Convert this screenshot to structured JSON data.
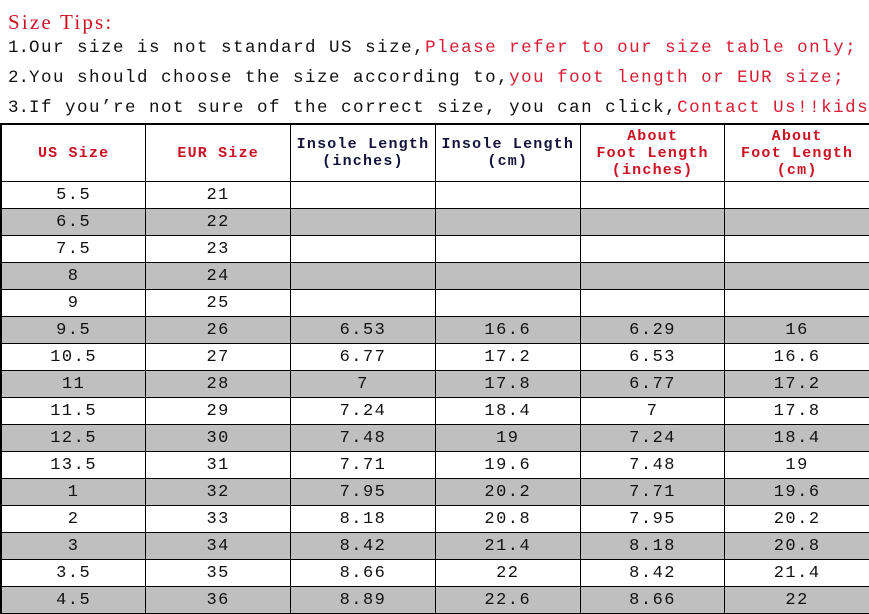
{
  "tips": {
    "title": "Size Tips:",
    "lines": [
      {
        "num": "1.",
        "black": "Our size is not standard US size,",
        "red": "Please refer to our size table only;"
      },
      {
        "num": "2.",
        "black": "You should choose the size according to,",
        "red": "you foot length or EUR size;"
      },
      {
        "num": "3.",
        "black": "If you’re not sure of the correct size, you can click,",
        "red": "Contact Us!!kids shoes"
      }
    ]
  },
  "table": {
    "headers": [
      {
        "line1": "US Size",
        "line2": "",
        "line3": "",
        "color": "red"
      },
      {
        "line1": "EUR Size",
        "line2": "",
        "line3": "",
        "color": "red"
      },
      {
        "line1": "Insole Length",
        "line2": "(inches)",
        "line3": "",
        "color": "black"
      },
      {
        "line1": "Insole Length",
        "line2": "(cm)",
        "line3": "",
        "color": "black"
      },
      {
        "line1": "About",
        "line2": "Foot Length",
        "line3": "(inches)",
        "color": "red"
      },
      {
        "line1": "About",
        "line2": "Foot Length",
        "line3": "(cm)",
        "color": "red"
      }
    ],
    "rows": [
      {
        "shaded": false,
        "cells": [
          "5.5",
          "21",
          "",
          "",
          "",
          ""
        ]
      },
      {
        "shaded": true,
        "cells": [
          "6.5",
          "22",
          "",
          "",
          "",
          ""
        ]
      },
      {
        "shaded": false,
        "cells": [
          "7.5",
          "23",
          "",
          "",
          "",
          ""
        ]
      },
      {
        "shaded": true,
        "cells": [
          "8",
          "24",
          "",
          "",
          "",
          ""
        ]
      },
      {
        "shaded": false,
        "cells": [
          "9",
          "25",
          "",
          "",
          "",
          ""
        ]
      },
      {
        "shaded": true,
        "cells": [
          "9.5",
          "26",
          "6.53",
          "16.6",
          "6.29",
          "16"
        ]
      },
      {
        "shaded": false,
        "cells": [
          "10.5",
          "27",
          "6.77",
          "17.2",
          "6.53",
          "16.6"
        ]
      },
      {
        "shaded": true,
        "cells": [
          "11",
          "28",
          "7",
          "17.8",
          "6.77",
          "17.2"
        ]
      },
      {
        "shaded": false,
        "cells": [
          "11.5",
          "29",
          "7.24",
          "18.4",
          "7",
          "17.8"
        ]
      },
      {
        "shaded": true,
        "cells": [
          "12.5",
          "30",
          "7.48",
          "19",
          "7.24",
          "18.4"
        ]
      },
      {
        "shaded": false,
        "cells": [
          "13.5",
          "31",
          "7.71",
          "19.6",
          "7.48",
          "19"
        ]
      },
      {
        "shaded": true,
        "cells": [
          "1",
          "32",
          "7.95",
          "20.2",
          "7.71",
          "19.6"
        ]
      },
      {
        "shaded": false,
        "cells": [
          "2",
          "33",
          "8.18",
          "20.8",
          "7.95",
          "20.2"
        ]
      },
      {
        "shaded": true,
        "cells": [
          "3",
          "34",
          "8.42",
          "21.4",
          "8.18",
          "20.8"
        ]
      },
      {
        "shaded": false,
        "cells": [
          "3.5",
          "35",
          "8.66",
          "22",
          "8.42",
          "21.4"
        ]
      },
      {
        "shaded": true,
        "cells": [
          "4.5",
          "36",
          "8.89",
          "22.6",
          "8.66",
          "22"
        ]
      }
    ]
  },
  "colors": {
    "red": "#cc1122",
    "tip_red": "#d81c33",
    "shade_gray": "#bfbfbf",
    "text_black": "#111111",
    "border": "#000000"
  }
}
